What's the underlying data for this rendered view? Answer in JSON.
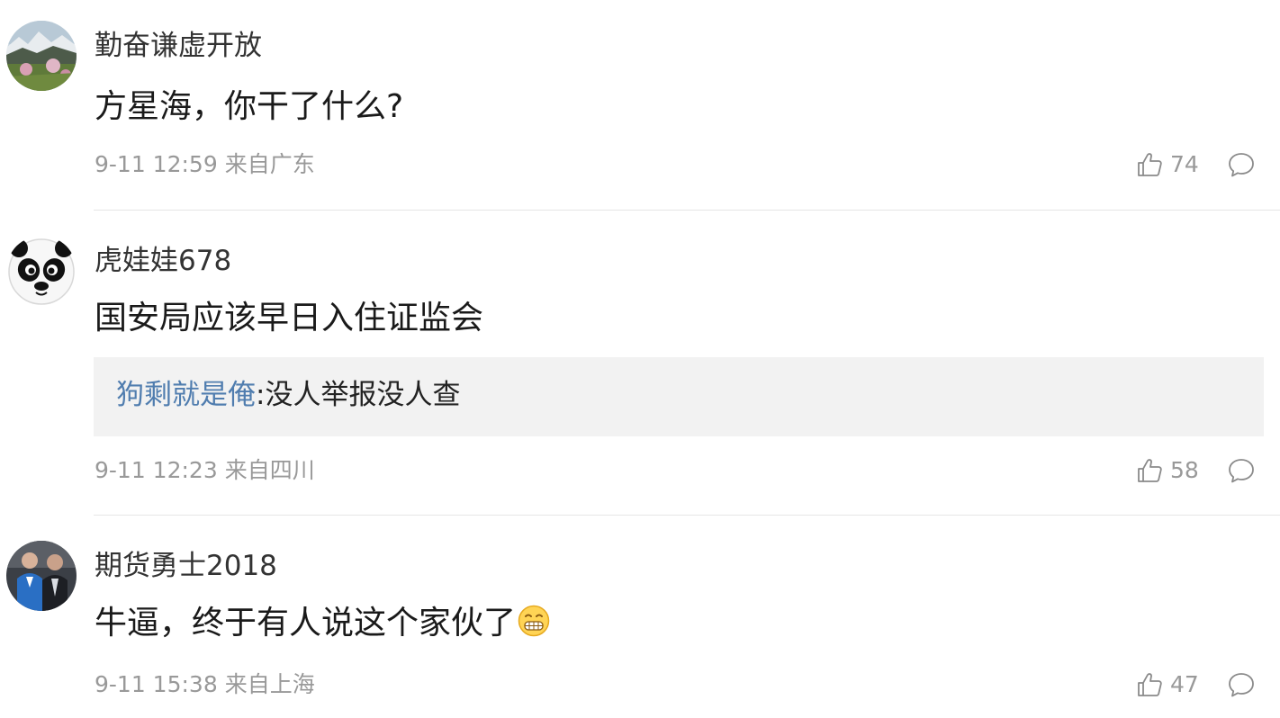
{
  "comments": [
    {
      "avatar": "landscape-avatar",
      "username": "勤奋谦虚开放",
      "text": "方星海，你干了什么?",
      "time": "9-11 12:59",
      "location": "来自广东",
      "likes": "74"
    },
    {
      "avatar": "panda-avatar",
      "username": "虎娃娃678",
      "text": "国安局应该早日入住证监会",
      "reply": {
        "user": "狗剩就是俺",
        "separator": ":",
        "text": "没人举报没人查"
      },
      "time": "9-11 12:23",
      "location": "来自四川",
      "likes": "58"
    },
    {
      "avatar": "two-men-avatar",
      "username": "期货勇士2018",
      "text": "牛逼，终于有人说这个家伙了",
      "emoji": "grin-emoji",
      "time": "9-11 15:38",
      "location": "来自上海",
      "likes": "47"
    }
  ],
  "icons": {
    "like": "thumbs-up-icon",
    "reply": "speech-bubble-icon"
  },
  "colors": {
    "reply_user": "#507daf",
    "meta_text": "#999999",
    "reply_bg": "#f2f2f2",
    "divider": "#e6e6e6"
  }
}
